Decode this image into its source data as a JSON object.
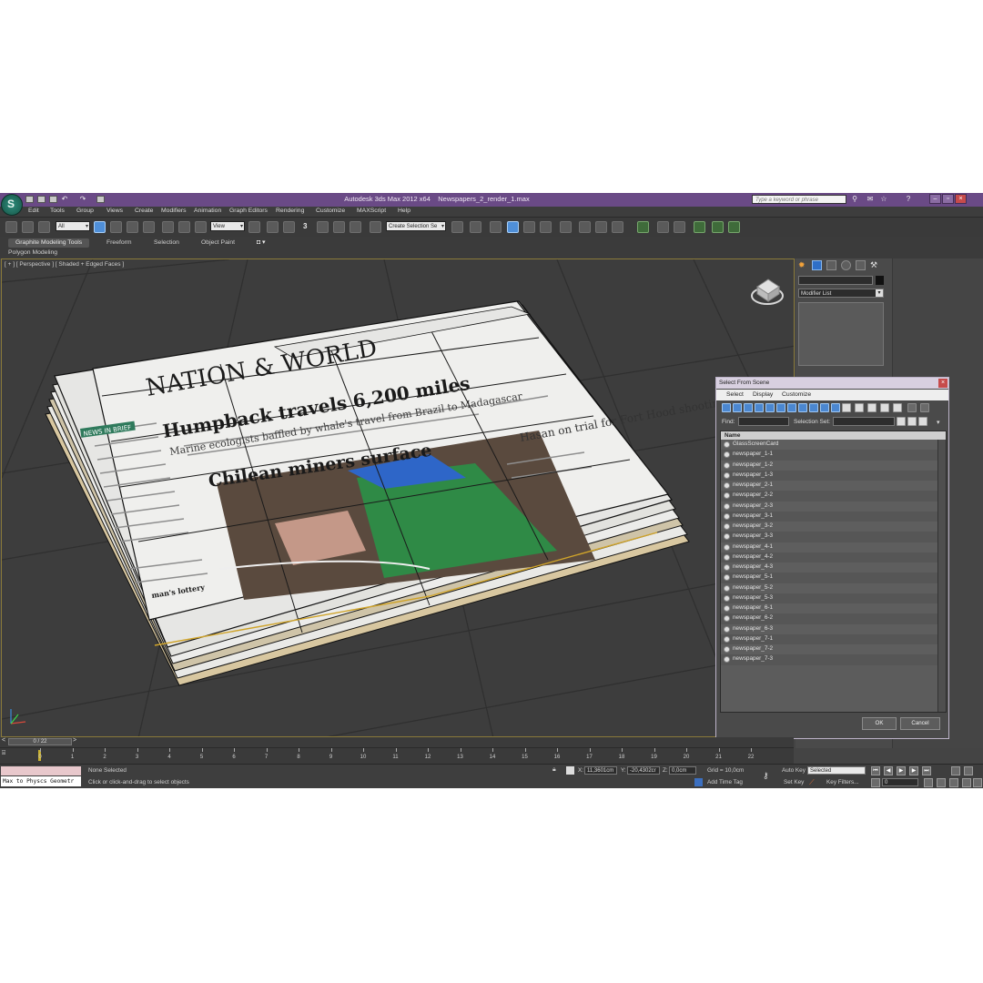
{
  "app": {
    "title": "Autodesk 3ds Max  2012 x64",
    "file": "Newspapers_2_render_1.max",
    "search_placeholder": "Type a keyword or phrase",
    "menu": [
      "Edit",
      "Tools",
      "Group",
      "Views",
      "Create",
      "Modifiers",
      "Animation",
      "Graph Editors",
      "Rendering",
      "Customize",
      "MAXScript",
      "Help"
    ]
  },
  "toolbar": {
    "selection_filter": "All",
    "reference_coord": "View",
    "named_selection": "Create Selection Se",
    "snap_number": "3"
  },
  "ribbon": {
    "tabs": [
      "Graphite Modeling Tools",
      "Freeform",
      "Selection",
      "Object Paint"
    ],
    "subtitle": "Polygon Modeling"
  },
  "viewport": {
    "label": "[ + ] [ Perspective ] [ Shaded + Edged Faces ]",
    "newspaper": {
      "masthead": "NATION & WORLD",
      "headline1": "Humpback travels 6,200 miles",
      "subhead": "Marine ecologists baffled by whale's travel from Brazil to Madagascar",
      "headline2": "Chilean miners surface",
      "side": "Hasan on trial for Fort Hood shooting",
      "brief": "NEWS IN BRIEF",
      "lottery": "man's lottery"
    }
  },
  "command_panel": {
    "modifier_list": "Modifier List"
  },
  "dialog": {
    "title": "Select From Scene",
    "menu": [
      "Select",
      "Display",
      "Customize"
    ],
    "find_label": "Find:",
    "selection_set_label": "Selection Set:",
    "column_name": "Name",
    "items": [
      "GlassScreenCard",
      "newspaper_1-1",
      "newspaper_1-2",
      "newspaper_1-3",
      "newspaper_2-1",
      "newspaper_2-2",
      "newspaper_2-3",
      "newspaper_3-1",
      "newspaper_3-2",
      "newspaper_3-3",
      "newspaper_4-1",
      "newspaper_4-2",
      "newspaper_4-3",
      "newspaper_5-1",
      "newspaper_5-2",
      "newspaper_5-3",
      "newspaper_6-1",
      "newspaper_6-2",
      "newspaper_6-3",
      "newspaper_7-1",
      "newspaper_7-2",
      "newspaper_7-3"
    ],
    "ok": "OK",
    "cancel": "Cancel"
  },
  "timeline": {
    "frame_readout": "0 / 22",
    "ticks": [
      "0",
      "1",
      "2",
      "3",
      "4",
      "5",
      "6",
      "7",
      "8",
      "9",
      "10",
      "11",
      "12",
      "13",
      "14",
      "15",
      "16",
      "17",
      "18",
      "19",
      "20",
      "21",
      "22"
    ]
  },
  "status": {
    "script_listener": "Max to Physcs Geometr",
    "selection": "None Selected",
    "prompt": "Click or click-and-drag to select objects",
    "x_label": "X:",
    "x_value": "11,3601cm",
    "y_label": "Y:",
    "y_value": "-20,4302cr",
    "z_label": "Z:",
    "z_value": "0,0cm",
    "grid": "Grid = 10,0cm",
    "add_time_tag": "Add Time Tag",
    "auto_key": "Auto Key",
    "set_key": "Set Key",
    "key_mode": "Selected",
    "key_filters": "Key Filters...",
    "current_frame": "0"
  }
}
